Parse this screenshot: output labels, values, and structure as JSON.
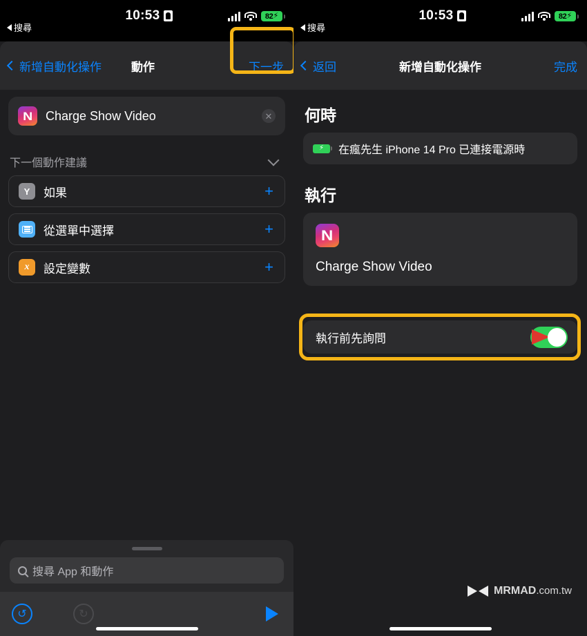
{
  "status_bar": {
    "time": "10:53",
    "back_label": "搜尋",
    "battery_percent": "82",
    "battery_charging": true,
    "signal_icon": "cellular-bars-icon",
    "wifi_icon": "wifi-icon",
    "lock_icon": "lock-portrait-icon"
  },
  "left_screen": {
    "nav": {
      "back_label": "新增自動化操作",
      "title": "動作",
      "next_label": "下一步",
      "highlight_color": "#f5b517"
    },
    "action_card": {
      "title": "Charge Show Video",
      "icon": "shortcut-app-icon",
      "clear_label": "✕"
    },
    "suggestions": {
      "header": "下一個動作建議",
      "items": [
        {
          "label": "如果",
          "icon": "if-branch-icon",
          "icon_color": "#8e8e93",
          "add_label": "+"
        },
        {
          "label": "從選單中選擇",
          "icon": "menu-select-icon",
          "icon_color": "#4fb0f7",
          "add_label": "+"
        },
        {
          "label": "設定變數",
          "icon": "set-variable-icon",
          "icon_color": "#f09a2b",
          "add_label": "+"
        }
      ]
    },
    "bottom_bar": {
      "search_placeholder": "搜尋 App 和動作",
      "undo_icon": "undo-icon",
      "redo_icon": "redo-icon",
      "play_icon": "play-icon"
    }
  },
  "right_screen": {
    "nav": {
      "back_label": "返回",
      "title": "新增自動化操作",
      "done_label": "完成"
    },
    "when": {
      "section_title": "何時",
      "trigger_text": "在瘋先生 iPhone 14 Pro 已連接電源時",
      "trigger_icon": "battery-charging-icon"
    },
    "run": {
      "section_title": "執行",
      "shortcut_name": "Charge Show Video",
      "icon": "shortcut-app-icon"
    },
    "ask_before_running": {
      "label": "執行前先詢問",
      "toggle_on": true,
      "toggle_color": "#30d158",
      "annotation_arrow_color": "#e0372e",
      "highlight_color": "#f5b517"
    },
    "watermark": {
      "brand": "MRMAD",
      "domain": ".com.tw",
      "logo": "mrmad-bowtie-logo"
    }
  }
}
